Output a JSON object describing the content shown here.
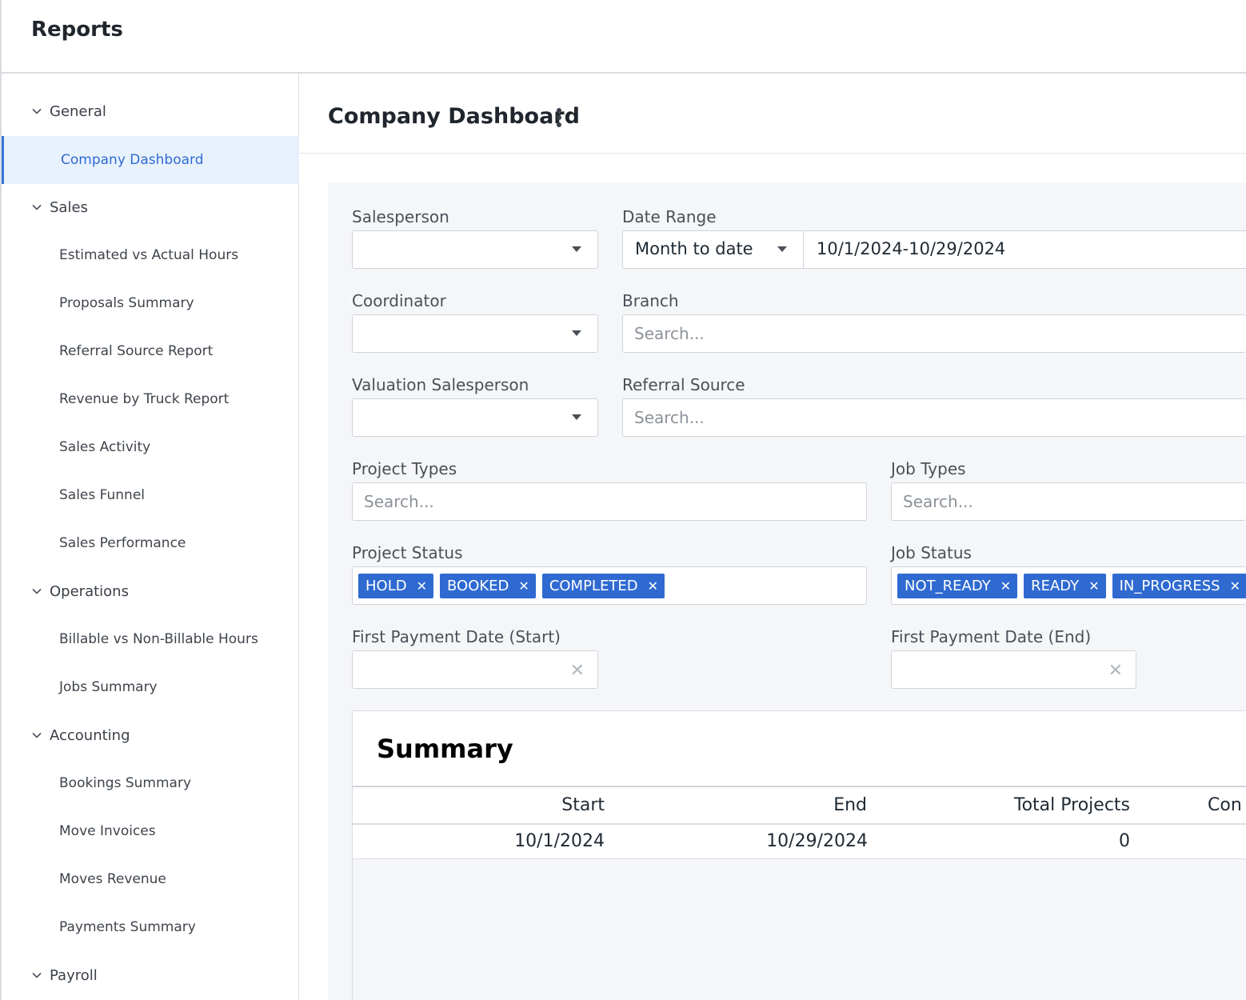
{
  "app": {
    "title": "Reports"
  },
  "sidebar": {
    "groups": [
      {
        "label": "General",
        "items": [
          {
            "label": "Company Dashboard",
            "active": true
          }
        ]
      },
      {
        "label": "Sales",
        "items": [
          {
            "label": "Estimated vs Actual Hours"
          },
          {
            "label": "Proposals Summary"
          },
          {
            "label": "Referral Source Report"
          },
          {
            "label": "Revenue by Truck Report"
          },
          {
            "label": "Sales Activity"
          },
          {
            "label": "Sales Funnel"
          },
          {
            "label": "Sales Performance"
          }
        ]
      },
      {
        "label": "Operations",
        "items": [
          {
            "label": "Billable vs Non-Billable Hours"
          },
          {
            "label": "Jobs Summary"
          }
        ]
      },
      {
        "label": "Accounting",
        "items": [
          {
            "label": "Bookings Summary"
          },
          {
            "label": "Move Invoices"
          },
          {
            "label": "Moves Revenue"
          },
          {
            "label": "Payments Summary"
          }
        ]
      },
      {
        "label": "Payroll",
        "items": []
      }
    ]
  },
  "page": {
    "title": "Company Dashboard"
  },
  "filters": {
    "salesperson": {
      "label": "Salesperson",
      "value": ""
    },
    "date_range": {
      "label": "Date Range",
      "preset": "Month to date",
      "value": "10/1/2024-10/29/2024"
    },
    "coordinator": {
      "label": "Coordinator",
      "value": ""
    },
    "branch": {
      "label": "Branch",
      "placeholder": "Search..."
    },
    "valuation_salesperson": {
      "label": "Valuation Salesperson",
      "value": ""
    },
    "referral_source": {
      "label": "Referral Source",
      "placeholder": "Search..."
    },
    "project_types": {
      "label": "Project Types",
      "placeholder": "Search..."
    },
    "job_types": {
      "label": "Job Types",
      "placeholder": "Search..."
    },
    "project_status": {
      "label": "Project Status",
      "tags": [
        "HOLD",
        "BOOKED",
        "COMPLETED"
      ]
    },
    "job_status": {
      "label": "Job Status",
      "tags": [
        "NOT_READY",
        "READY",
        "IN_PROGRESS"
      ]
    },
    "first_payment_start": {
      "label": "First Payment Date (Start)",
      "value": ""
    },
    "first_payment_end": {
      "label": "First Payment Date (End)",
      "value": ""
    }
  },
  "summary": {
    "title": "Summary",
    "columns": [
      "Start",
      "End",
      "Total Projects",
      "Con"
    ],
    "rows": [
      {
        "start": "10/1/2024",
        "end": "10/29/2024",
        "total_projects": "0"
      }
    ]
  },
  "icons": {
    "group_toggle": "chevron-down-icon",
    "menu": "kebab-menu-icon",
    "dropdown": "caret-down-icon",
    "clear": "close-icon",
    "tag_remove": "close-icon"
  },
  "colors": {
    "accent": "#2f6ad1",
    "active_bg": "#e8f2fd",
    "panel_bg": "#f5f6f8"
  }
}
